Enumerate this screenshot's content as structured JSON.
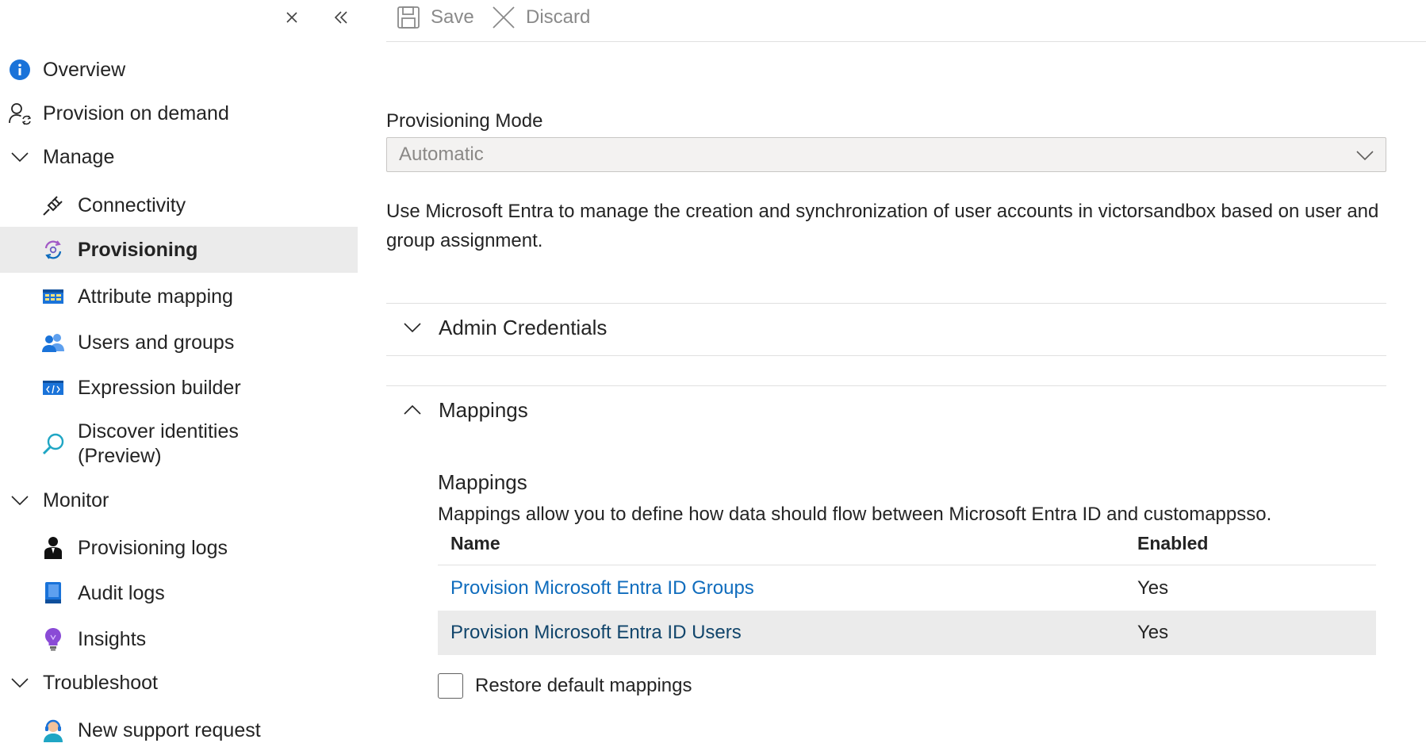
{
  "toolbar": {
    "save_label": "Save",
    "discard_label": "Discard"
  },
  "sidebar": {
    "close_icon": "close-icon",
    "collapse_icon": "double-chevron-left-icon",
    "items": [
      {
        "label": "Overview",
        "icon": "info-icon"
      },
      {
        "label": "Provision on demand",
        "icon": "user-sync-icon"
      },
      {
        "label": "Manage",
        "icon": "chevron-down-icon"
      },
      {
        "label": "Connectivity",
        "icon": "plug-icon"
      },
      {
        "label": "Provisioning",
        "icon": "provisioning-icon"
      },
      {
        "label": "Attribute mapping",
        "icon": "table-icon"
      },
      {
        "label": "Users and groups",
        "icon": "users-icon"
      },
      {
        "label": "Expression builder",
        "icon": "code-icon"
      },
      {
        "label": "Discover identities",
        "label2": "(Preview)",
        "icon": "search-icon"
      },
      {
        "label": "Monitor",
        "icon": "chevron-down-icon"
      },
      {
        "label": "Provisioning logs",
        "icon": "log-user-icon"
      },
      {
        "label": "Audit logs",
        "icon": "book-icon"
      },
      {
        "label": "Insights",
        "icon": "lightbulb-icon"
      },
      {
        "label": "Troubleshoot",
        "icon": "chevron-down-icon"
      },
      {
        "label": "New support request",
        "icon": "support-agent-icon"
      }
    ]
  },
  "main": {
    "mode_label": "Provisioning Mode",
    "mode_value": "Automatic",
    "description": "Use Microsoft Entra to manage the creation and synchronization of user accounts in victorsandbox based on user and group assignment.",
    "admin_credentials_label": "Admin Credentials",
    "mappings_section_label": "Mappings",
    "mappings_title": "Mappings",
    "mappings_desc": "Mappings allow you to define how data should flow between Microsoft Entra ID and customappsso.",
    "table": {
      "headers": [
        "Name",
        "Enabled"
      ],
      "rows": [
        {
          "name": "Provision Microsoft Entra ID Groups",
          "enabled": "Yes"
        },
        {
          "name": "Provision Microsoft Entra ID Users",
          "enabled": "Yes"
        }
      ]
    },
    "restore_label": "Restore default mappings"
  },
  "colors": {
    "accent": "#0f6cbd",
    "active_bg": "#ebebeb",
    "divider": "#e0e0e0"
  }
}
